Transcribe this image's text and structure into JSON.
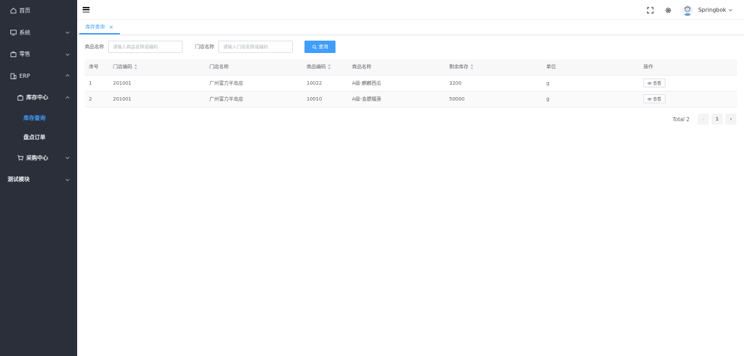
{
  "sidebar": {
    "items": [
      {
        "label": "首页",
        "icon": "home-icon"
      },
      {
        "label": "系统",
        "icon": "monitor-icon"
      },
      {
        "label": "零售",
        "icon": "bag-icon"
      },
      {
        "label": "ERP",
        "icon": "building-icon"
      },
      {
        "label": "库存中心",
        "icon": "box-icon"
      },
      {
        "label": "库存查询"
      },
      {
        "label": "盘点订单"
      },
      {
        "label": "采购中心",
        "icon": "cart-icon"
      },
      {
        "label": "测试模块"
      }
    ]
  },
  "navbar": {
    "username": "Springbok"
  },
  "tags": [
    {
      "label": "库存查询",
      "close": "×"
    }
  ],
  "filters": {
    "product_label": "商品名称",
    "product_placeholder": "请输入商品名称或编码",
    "store_label": "门店名称",
    "store_placeholder": "请输入门店名称或编码",
    "search_label": "查询"
  },
  "table": {
    "headers": [
      "序号",
      "门店编码",
      "门店名称",
      "商品编码",
      "商品名称",
      "剩余库存",
      "单位",
      "操作"
    ],
    "rows": [
      [
        "1",
        "201001",
        "广州富力半岛店",
        "10022",
        "A级-麒麟西瓜",
        "3200",
        "g",
        "查看"
      ],
      [
        "2",
        "201001",
        "广州富力半岛店",
        "10010",
        "A级-金膘榴莲",
        "50000",
        "g",
        "查看"
      ]
    ]
  },
  "pagination": {
    "total": "Total 2",
    "prev": "‹",
    "page": "1",
    "next": "›"
  },
  "colors": {
    "accent": "#409eff",
    "sidebar_bg": "#2b2f3a"
  }
}
